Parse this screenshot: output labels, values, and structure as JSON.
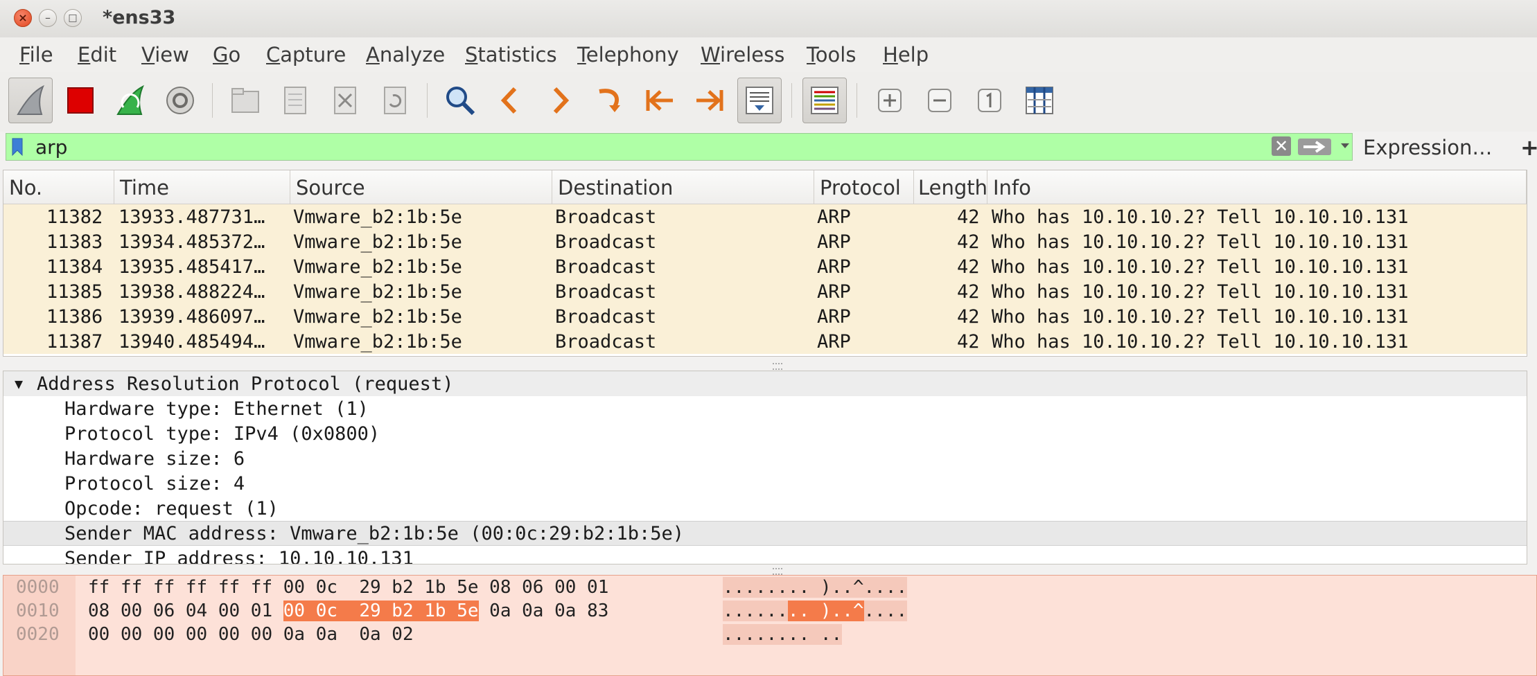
{
  "window": {
    "title": "*ens33",
    "close": "×",
    "minimize": "–",
    "maximize": "□"
  },
  "menu": [
    {
      "u": "F",
      "rest": "ile"
    },
    {
      "u": "E",
      "rest": "dit"
    },
    {
      "u": "V",
      "rest": "iew"
    },
    {
      "u": "G",
      "rest": "o"
    },
    {
      "u": "C",
      "rest": "apture"
    },
    {
      "u": "A",
      "rest": "nalyze"
    },
    {
      "u": "S",
      "rest": "tatistics"
    },
    {
      "u": "T",
      "rest": "elephony"
    },
    {
      "u": "W",
      "rest": "ireless"
    },
    {
      "u": "T",
      "rest": "ools"
    },
    {
      "u": "H",
      "rest": "elp"
    }
  ],
  "filter": {
    "value": "arp",
    "expression_label": "Expression…",
    "add_label": "+"
  },
  "columns": [
    "No.",
    "Time",
    "Source",
    "Destination",
    "Protocol",
    "Length",
    "Info"
  ],
  "packets": [
    {
      "no": "11382",
      "time": "13933.487731…",
      "src": "Vmware_b2:1b:5e",
      "dst": "Broadcast",
      "proto": "ARP",
      "len": "42",
      "info": "Who has 10.10.10.2? Tell 10.10.10.131"
    },
    {
      "no": "11383",
      "time": "13934.485372…",
      "src": "Vmware_b2:1b:5e",
      "dst": "Broadcast",
      "proto": "ARP",
      "len": "42",
      "info": "Who has 10.10.10.2? Tell 10.10.10.131"
    },
    {
      "no": "11384",
      "time": "13935.485417…",
      "src": "Vmware_b2:1b:5e",
      "dst": "Broadcast",
      "proto": "ARP",
      "len": "42",
      "info": "Who has 10.10.10.2? Tell 10.10.10.131"
    },
    {
      "no": "11385",
      "time": "13938.488224…",
      "src": "Vmware_b2:1b:5e",
      "dst": "Broadcast",
      "proto": "ARP",
      "len": "42",
      "info": "Who has 10.10.10.2? Tell 10.10.10.131"
    },
    {
      "no": "11386",
      "time": "13939.486097…",
      "src": "Vmware_b2:1b:5e",
      "dst": "Broadcast",
      "proto": "ARP",
      "len": "42",
      "info": "Who has 10.10.10.2? Tell 10.10.10.131"
    },
    {
      "no": "11387",
      "time": "13940.485494…",
      "src": "Vmware_b2:1b:5e",
      "dst": "Broadcast",
      "proto": "ARP",
      "len": "42",
      "info": "Who has 10.10.10.2? Tell 10.10.10.131"
    }
  ],
  "details": {
    "header": "Address Resolution Protocol (request)",
    "fields": [
      "Hardware type: Ethernet (1)",
      "Protocol type: IPv4 (0x0800)",
      "Hardware size: 6",
      "Protocol size: 4",
      "Opcode: request (1)",
      "Sender MAC address: Vmware_b2:1b:5e (00:0c:29:b2:1b:5e)",
      "Sender IP address: 10.10.10.131"
    ]
  },
  "bytes": [
    {
      "offset": "0000",
      "hex_a": "ff ff ff ff ff ff 00 0c  29 b2 1b 5e 08 06 00 01",
      "hex_hl": "",
      "hex_b": "",
      "ascii_a": "........ )..^....",
      "ascii_hl": "",
      "ascii_b": ""
    },
    {
      "offset": "0010",
      "hex_a": "08 00 06 04 00 01 ",
      "hex_hl": "00 0c  29 b2 1b 5e",
      "hex_b": " 0a 0a 0a 83",
      "ascii_a": "......",
      "ascii_hl": ".. )..^",
      "ascii_b": "...."
    },
    {
      "offset": "0020",
      "hex_a": "00 00 00 00 00 00 0a 0a  0a 02",
      "hex_hl": "",
      "hex_b": "",
      "ascii_a": "........ ..",
      "ascii_hl": "",
      "ascii_b": ""
    }
  ],
  "colors": {
    "filter_valid": "#afffa6",
    "row_arp": "#faf0d7",
    "bytes_highlight": "#f47b4a",
    "bytes_bg": "#fde1d8"
  },
  "icons": [
    "shark-fin-start-icon",
    "stop-square-icon",
    "restart-capture-icon",
    "capture-options-gear-icon",
    "open-file-icon",
    "save-file-icon",
    "close-file-icon",
    "reload-file-icon",
    "find-packet-icon",
    "go-back-icon",
    "go-forward-icon",
    "go-to-packet-icon",
    "first-packet-icon",
    "last-packet-icon",
    "autoscroll-icon",
    "colorize-icon",
    "zoom-in-icon",
    "zoom-out-icon",
    "normal-size-icon",
    "resize-columns-icon"
  ]
}
